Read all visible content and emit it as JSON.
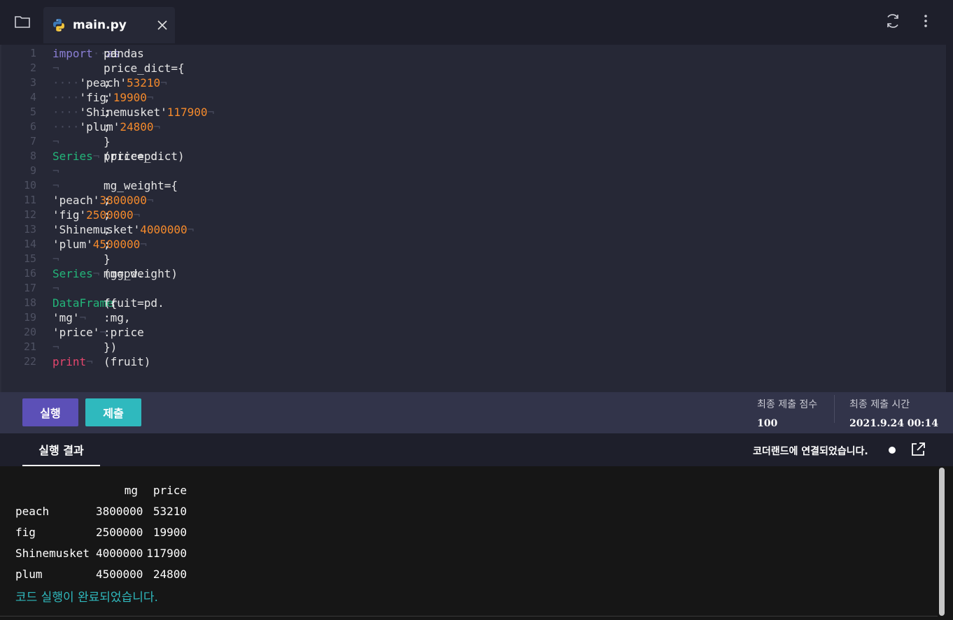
{
  "file_tab": {
    "label": "main.py"
  },
  "code_lines": [
    {
      "n": "1",
      "parts": [
        [
          "kw",
          "import"
        ],
        [
          "ws",
          "·"
        ],
        [
          "code",
          "pandas"
        ],
        [
          "ws",
          "·"
        ],
        [
          "kw",
          "as"
        ],
        [
          "ws",
          "·"
        ],
        [
          "code",
          "pd"
        ],
        [
          "eol",
          "¬"
        ]
      ]
    },
    {
      "n": "2",
      "parts": [
        [
          "code",
          "price_dict={"
        ],
        [
          "eol",
          "¬"
        ]
      ]
    },
    {
      "n": "3",
      "parts": [
        [
          "ws",
          "····"
        ],
        [
          "str",
          "'peach'"
        ],
        [
          "code",
          ":"
        ],
        [
          "num",
          "53210"
        ],
        [
          "code",
          ","
        ],
        [
          "eol",
          "¬"
        ]
      ]
    },
    {
      "n": "4",
      "parts": [
        [
          "ws",
          "····"
        ],
        [
          "str",
          "'fig'"
        ],
        [
          "code",
          ":"
        ],
        [
          "num",
          "19900"
        ],
        [
          "code",
          ","
        ],
        [
          "eol",
          "¬"
        ]
      ]
    },
    {
      "n": "5",
      "parts": [
        [
          "ws",
          "····"
        ],
        [
          "str",
          "'Shinemusket'"
        ],
        [
          "code",
          ":"
        ],
        [
          "num",
          "117900"
        ],
        [
          "code",
          ","
        ],
        [
          "eol",
          "¬"
        ]
      ]
    },
    {
      "n": "6",
      "parts": [
        [
          "ws",
          "····"
        ],
        [
          "str",
          "'plum'"
        ],
        [
          "code",
          ":"
        ],
        [
          "num",
          "24800"
        ],
        [
          "code",
          ","
        ],
        [
          "eol",
          "¬"
        ]
      ]
    },
    {
      "n": "7",
      "parts": [
        [
          "code",
          "}"
        ],
        [
          "eol",
          "¬"
        ]
      ]
    },
    {
      "n": "8",
      "parts": [
        [
          "code",
          "price=pd."
        ],
        [
          "fn",
          "Series"
        ],
        [
          "code",
          "(price_dict)"
        ],
        [
          "eol",
          "¬"
        ]
      ]
    },
    {
      "n": "9",
      "parts": [
        [
          "eol",
          "¬"
        ]
      ]
    },
    {
      "n": "10",
      "parts": [
        [
          "code",
          "mg_weight={"
        ],
        [
          "eol",
          "¬"
        ]
      ]
    },
    {
      "n": "11",
      "parts": [
        [
          "code",
          "    "
        ],
        [
          "str",
          "'peach'"
        ],
        [
          "code",
          ":"
        ],
        [
          "num",
          "3800000"
        ],
        [
          "code",
          ","
        ],
        [
          "eol",
          "¬"
        ]
      ]
    },
    {
      "n": "12",
      "parts": [
        [
          "code",
          "    "
        ],
        [
          "str",
          "'fig'"
        ],
        [
          "code",
          ":"
        ],
        [
          "num",
          "2500000"
        ],
        [
          "code",
          ","
        ],
        [
          "eol",
          "¬"
        ]
      ]
    },
    {
      "n": "13",
      "parts": [
        [
          "code",
          "    "
        ],
        [
          "str",
          "'Shinemusket'"
        ],
        [
          "code",
          ":"
        ],
        [
          "num",
          "4000000"
        ],
        [
          "code",
          ","
        ],
        [
          "eol",
          "¬"
        ]
      ]
    },
    {
      "n": "14",
      "parts": [
        [
          "code",
          "    "
        ],
        [
          "str",
          "'plum'"
        ],
        [
          "code",
          ":"
        ],
        [
          "num",
          "4500000"
        ],
        [
          "code",
          ","
        ],
        [
          "eol",
          "¬"
        ]
      ]
    },
    {
      "n": "15",
      "parts": [
        [
          "code",
          "}"
        ],
        [
          "eol",
          "¬"
        ]
      ]
    },
    {
      "n": "16",
      "parts": [
        [
          "code",
          "mg=pd."
        ],
        [
          "fn",
          "Series"
        ],
        [
          "code",
          "(mg_weight)"
        ],
        [
          "eol",
          "¬"
        ]
      ]
    },
    {
      "n": "17",
      "parts": [
        [
          "eol",
          "¬"
        ]
      ]
    },
    {
      "n": "18",
      "parts": [
        [
          "code",
          "fruit=pd."
        ],
        [
          "fn",
          "DataFrame"
        ],
        [
          "code",
          "({"
        ],
        [
          "eol",
          "¬"
        ]
      ]
    },
    {
      "n": "19",
      "parts": [
        [
          "code",
          "    "
        ],
        [
          "str",
          "'mg'"
        ],
        [
          "code",
          ":mg,    "
        ],
        [
          "eol",
          "¬"
        ]
      ]
    },
    {
      "n": "20",
      "parts": [
        [
          "code",
          "    "
        ],
        [
          "str",
          "'price'"
        ],
        [
          "code",
          ":price   "
        ],
        [
          "eol",
          "¬"
        ]
      ]
    },
    {
      "n": "21",
      "parts": [
        [
          "code",
          "})"
        ],
        [
          "eol",
          "¬"
        ]
      ]
    },
    {
      "n": "22",
      "parts": [
        [
          "pr",
          "print"
        ],
        [
          "code",
          "(fruit)"
        ],
        [
          "eol",
          "¬"
        ]
      ]
    }
  ],
  "actions": {
    "run_label": "실행",
    "submit_label": "제출"
  },
  "stats": {
    "score_label": "최종 제출 점수",
    "score_value": "100",
    "time_label": "최종 제출 시간",
    "time_value": "2021.9.24 00:14"
  },
  "output_header": {
    "tab_label": "실행 결과",
    "connection_text": "코더랜드에 연결되었습니다."
  },
  "output": {
    "columns": [
      "mg",
      "price"
    ],
    "rows": [
      {
        "index": "peach",
        "mg": "3800000",
        "price": "53210"
      },
      {
        "index": "fig",
        "mg": "2500000",
        "price": "19900"
      },
      {
        "index": "Shinemusket",
        "mg": "4000000",
        "price": "117900"
      },
      {
        "index": "plum",
        "mg": "4500000",
        "price": "24800"
      }
    ],
    "done_message": "코드 실행이 완료되었습니다."
  },
  "colors": {
    "run_button": "#5c50b7",
    "submit_button": "#2fb9be",
    "keyword": "#8b7fd6",
    "function": "#23b67a",
    "number": "#f58a2c",
    "print": "#e6466e",
    "done_message": "#2fb9be"
  },
  "icons": {
    "folder": "folder-icon",
    "file": "python-icon",
    "close": "close-icon",
    "refresh": "refresh-icon",
    "more": "more-vertical-icon",
    "connection": "status-dot-icon",
    "popout": "external-link-icon"
  }
}
